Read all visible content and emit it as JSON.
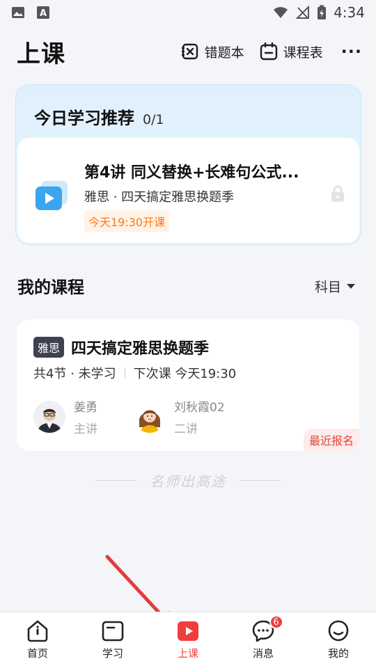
{
  "status_bar": {
    "time": "4:34",
    "icons": [
      "image-icon",
      "a-icon",
      "wifi-icon",
      "no-signal-icon",
      "battery-charging-icon"
    ]
  },
  "header": {
    "title": "上课",
    "actions": [
      {
        "label": "错题本",
        "icon": "mistakes-book-icon"
      },
      {
        "label": "课程表",
        "icon": "calendar-icon"
      }
    ],
    "more": "···"
  },
  "recommendation": {
    "title": "今日学习推荐",
    "count": "0/1",
    "lesson": {
      "title": "第4讲 同义替换+长难句公式...",
      "subtitle": "雅思 · 四天搞定雅思换题季",
      "tag": "今天19:30开课",
      "icon": "video-play-icon",
      "lock_icon": "lock-icon"
    }
  },
  "my_courses": {
    "title": "我的课程",
    "filter": "科目",
    "courses": [
      {
        "badge": "雅思",
        "title": "四天搞定雅思换题季",
        "meta_left": "共4节 · 未学习",
        "meta_right": "下次课 今天19:30",
        "teachers": [
          {
            "name": "姜勇",
            "role": "主讲"
          },
          {
            "name": "刘秋霞02",
            "role": "二讲"
          }
        ],
        "tag": "最近报名"
      }
    ]
  },
  "watermark": "名师出高途",
  "bottom_nav": {
    "active_index": 2,
    "items": [
      {
        "label": "首页",
        "icon": "home-icon"
      },
      {
        "label": "学习",
        "icon": "study-book-icon"
      },
      {
        "label": "上课",
        "icon": "play-class-icon"
      },
      {
        "label": "消息",
        "icon": "message-icon",
        "badge": "6"
      },
      {
        "label": "我的",
        "icon": "profile-icon"
      }
    ]
  },
  "colors": {
    "accent_red": "#f23d3d",
    "orange_tag": "#ff7a1a",
    "annotation_arrow": "#e23c3c"
  }
}
